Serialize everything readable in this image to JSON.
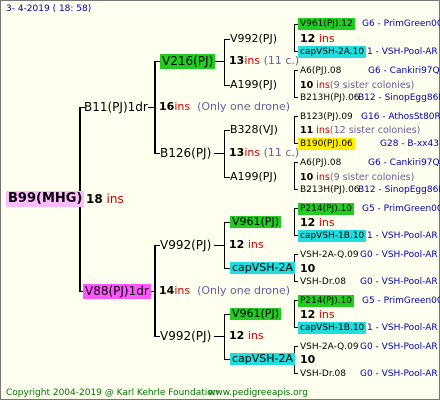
{
  "header": {
    "date": "3-  4-2019  ( 18:  58)"
  },
  "footer": {
    "copyright": "Copyright 2004-2019 @ Karl Kehrle Foundation",
    "site": "www.pedigreeapis.org"
  },
  "colors": {
    "green": "#22cc22",
    "cyan": "#22dddd",
    "magenta": "#ff55ff",
    "yellow": "#ffee00",
    "pink": "#ffbbff",
    "red": "#cc0000",
    "blue": "#0000aa"
  },
  "root": {
    "name": "B99(MHG)",
    "ins": "18",
    "ins_label": "ins"
  },
  "gen1": [
    {
      "name": "B11(PJ)1dr",
      "ins": "16",
      "ins_label": "ins",
      "note": "(Only one drone)"
    },
    {
      "name": "V88(PJ)1dr",
      "ins": "14",
      "ins_label": "ins",
      "note": "(Only one drone)"
    }
  ],
  "gen2": [
    {
      "name": "V216(PJ)",
      "ins": "13",
      "ins_label": "ins",
      "note": "(11 c.)"
    },
    {
      "name": "B126(PJ)",
      "ins": "13",
      "ins_label": "ins",
      "note": "(11 c.)"
    },
    {
      "name": "V992(PJ)",
      "ins": "12",
      "ins_label": "ins"
    },
    {
      "name": "V992(PJ)",
      "ins": "12",
      "ins_label": "ins"
    }
  ],
  "gen3": [
    {
      "name": "V992(PJ)",
      "ins": "12",
      "ins_label": "ins"
    },
    {
      "name": "A199(PJ)",
      "ins": "10",
      "ins_label": "ins",
      "note": "(9 sister colonies)"
    },
    {
      "name": "B328(VJ)",
      "ins": "11",
      "ins_label": "ins",
      "note": "(12 sister colonies)"
    },
    {
      "name": "A199(PJ)",
      "ins": "10",
      "ins_label": "ins",
      "note": "(9 sister colonies)"
    },
    {
      "name": "V961(PJ)",
      "ins": "12",
      "ins_label": "ins"
    },
    {
      "name": "capVSH-2A",
      "ins": "10"
    },
    {
      "name": "V961(PJ)",
      "ins": "12",
      "ins_label": "ins"
    },
    {
      "name": "capVSH-2A",
      "ins": "10"
    }
  ],
  "gen4": [
    {
      "name": "V961(PJ).12",
      "line": "G6 - PrimGreen00"
    },
    {
      "name": "capVSH-2A.10",
      "line": "1 - VSH-Pool-AR"
    },
    {
      "name": "A6(PJ).08",
      "line": "G6 - Cankiri97Q"
    },
    {
      "name": "B213H(PJ).06",
      "line": "B12 - SinopEgg86R"
    },
    {
      "name": "B123(PJ).09",
      "line": "G16 - AthosSt80R"
    },
    {
      "name": "B190(PJ).06",
      "line": "G28 - B-xx43"
    },
    {
      "name": "A6(PJ).08",
      "line": "G6 - Cankiri97Q"
    },
    {
      "name": "B213H(PJ).06",
      "line": "B12 - SinopEgg86R"
    },
    {
      "name": "P214(PJ).10",
      "line": "G5 - PrimGreen00"
    },
    {
      "name": "capVSH-1B.10",
      "line": "1 - VSH-Pool-AR"
    },
    {
      "name": "VSH-2A-Q.09",
      "line": "G0 - VSH-Pool-AR"
    },
    {
      "name": "VSH-Dr.08",
      "line": "G0 - VSH-Pool-AR"
    },
    {
      "name": "P214(PJ).10",
      "line": "G5 - PrimGreen00"
    },
    {
      "name": "capVSH-1B.10",
      "line": "1 - VSH-Pool-AR"
    },
    {
      "name": "VSH-2A-Q.09",
      "line": "G0 - VSH-Pool-AR"
    },
    {
      "name": "VSH-Dr.08",
      "line": "G0 - VSH-Pool-AR"
    }
  ]
}
